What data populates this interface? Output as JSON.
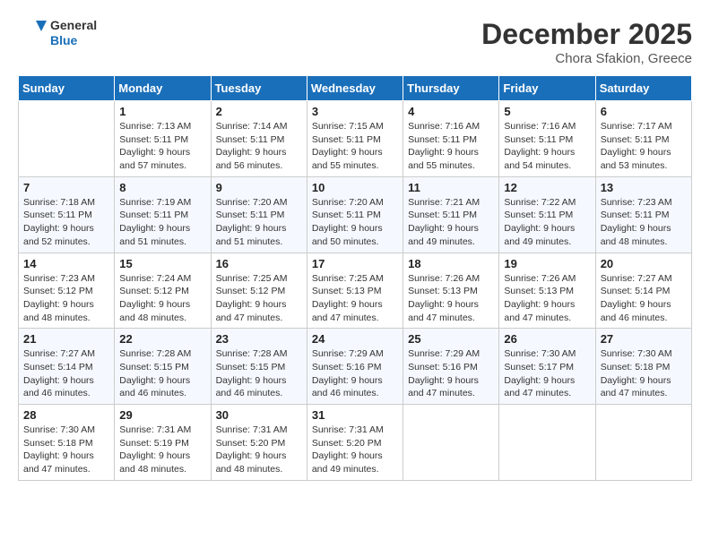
{
  "header": {
    "logo_line1": "General",
    "logo_line2": "Blue",
    "month": "December 2025",
    "location": "Chora Sfakion, Greece"
  },
  "days_of_week": [
    "Sunday",
    "Monday",
    "Tuesday",
    "Wednesday",
    "Thursday",
    "Friday",
    "Saturday"
  ],
  "weeks": [
    [
      {
        "day": "",
        "info": ""
      },
      {
        "day": "1",
        "info": "Sunrise: 7:13 AM\nSunset: 5:11 PM\nDaylight: 9 hours\nand 57 minutes."
      },
      {
        "day": "2",
        "info": "Sunrise: 7:14 AM\nSunset: 5:11 PM\nDaylight: 9 hours\nand 56 minutes."
      },
      {
        "day": "3",
        "info": "Sunrise: 7:15 AM\nSunset: 5:11 PM\nDaylight: 9 hours\nand 55 minutes."
      },
      {
        "day": "4",
        "info": "Sunrise: 7:16 AM\nSunset: 5:11 PM\nDaylight: 9 hours\nand 55 minutes."
      },
      {
        "day": "5",
        "info": "Sunrise: 7:16 AM\nSunset: 5:11 PM\nDaylight: 9 hours\nand 54 minutes."
      },
      {
        "day": "6",
        "info": "Sunrise: 7:17 AM\nSunset: 5:11 PM\nDaylight: 9 hours\nand 53 minutes."
      }
    ],
    [
      {
        "day": "7",
        "info": "Sunrise: 7:18 AM\nSunset: 5:11 PM\nDaylight: 9 hours\nand 52 minutes."
      },
      {
        "day": "8",
        "info": "Sunrise: 7:19 AM\nSunset: 5:11 PM\nDaylight: 9 hours\nand 51 minutes."
      },
      {
        "day": "9",
        "info": "Sunrise: 7:20 AM\nSunset: 5:11 PM\nDaylight: 9 hours\nand 51 minutes."
      },
      {
        "day": "10",
        "info": "Sunrise: 7:20 AM\nSunset: 5:11 PM\nDaylight: 9 hours\nand 50 minutes."
      },
      {
        "day": "11",
        "info": "Sunrise: 7:21 AM\nSunset: 5:11 PM\nDaylight: 9 hours\nand 49 minutes."
      },
      {
        "day": "12",
        "info": "Sunrise: 7:22 AM\nSunset: 5:11 PM\nDaylight: 9 hours\nand 49 minutes."
      },
      {
        "day": "13",
        "info": "Sunrise: 7:23 AM\nSunset: 5:11 PM\nDaylight: 9 hours\nand 48 minutes."
      }
    ],
    [
      {
        "day": "14",
        "info": "Sunrise: 7:23 AM\nSunset: 5:12 PM\nDaylight: 9 hours\nand 48 minutes."
      },
      {
        "day": "15",
        "info": "Sunrise: 7:24 AM\nSunset: 5:12 PM\nDaylight: 9 hours\nand 48 minutes."
      },
      {
        "day": "16",
        "info": "Sunrise: 7:25 AM\nSunset: 5:12 PM\nDaylight: 9 hours\nand 47 minutes."
      },
      {
        "day": "17",
        "info": "Sunrise: 7:25 AM\nSunset: 5:13 PM\nDaylight: 9 hours\nand 47 minutes."
      },
      {
        "day": "18",
        "info": "Sunrise: 7:26 AM\nSunset: 5:13 PM\nDaylight: 9 hours\nand 47 minutes."
      },
      {
        "day": "19",
        "info": "Sunrise: 7:26 AM\nSunset: 5:13 PM\nDaylight: 9 hours\nand 47 minutes."
      },
      {
        "day": "20",
        "info": "Sunrise: 7:27 AM\nSunset: 5:14 PM\nDaylight: 9 hours\nand 46 minutes."
      }
    ],
    [
      {
        "day": "21",
        "info": "Sunrise: 7:27 AM\nSunset: 5:14 PM\nDaylight: 9 hours\nand 46 minutes."
      },
      {
        "day": "22",
        "info": "Sunrise: 7:28 AM\nSunset: 5:15 PM\nDaylight: 9 hours\nand 46 minutes."
      },
      {
        "day": "23",
        "info": "Sunrise: 7:28 AM\nSunset: 5:15 PM\nDaylight: 9 hours\nand 46 minutes."
      },
      {
        "day": "24",
        "info": "Sunrise: 7:29 AM\nSunset: 5:16 PM\nDaylight: 9 hours\nand 46 minutes."
      },
      {
        "day": "25",
        "info": "Sunrise: 7:29 AM\nSunset: 5:16 PM\nDaylight: 9 hours\nand 47 minutes."
      },
      {
        "day": "26",
        "info": "Sunrise: 7:30 AM\nSunset: 5:17 PM\nDaylight: 9 hours\nand 47 minutes."
      },
      {
        "day": "27",
        "info": "Sunrise: 7:30 AM\nSunset: 5:18 PM\nDaylight: 9 hours\nand 47 minutes."
      }
    ],
    [
      {
        "day": "28",
        "info": "Sunrise: 7:30 AM\nSunset: 5:18 PM\nDaylight: 9 hours\nand 47 minutes."
      },
      {
        "day": "29",
        "info": "Sunrise: 7:31 AM\nSunset: 5:19 PM\nDaylight: 9 hours\nand 48 minutes."
      },
      {
        "day": "30",
        "info": "Sunrise: 7:31 AM\nSunset: 5:20 PM\nDaylight: 9 hours\nand 48 minutes."
      },
      {
        "day": "31",
        "info": "Sunrise: 7:31 AM\nSunset: 5:20 PM\nDaylight: 9 hours\nand 49 minutes."
      },
      {
        "day": "",
        "info": ""
      },
      {
        "day": "",
        "info": ""
      },
      {
        "day": "",
        "info": ""
      }
    ]
  ]
}
